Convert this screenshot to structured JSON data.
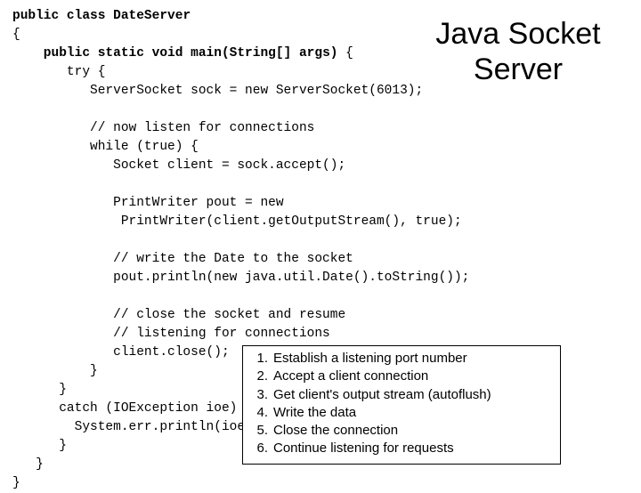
{
  "title": "Java Socket Server",
  "code": {
    "l01a": "public class ",
    "l01b": "DateServer",
    "l02": "{",
    "l03a": "    public static void ",
    "l03b": "main(String[] args)",
    "l03c": " {",
    "l04": "       try {",
    "l05": "          ServerSocket sock = new ServerSocket(6013);",
    "l06": "",
    "l07": "          // now listen for connections",
    "l08": "          while (true) {",
    "l09": "             Socket client = sock.accept();",
    "l10": "",
    "l11": "             PrintWriter pout = new",
    "l12": "              PrintWriter(client.getOutputStream(), true);",
    "l13": "",
    "l14": "             // write the Date to the socket",
    "l15": "             pout.println(new java.util.Date().toString());",
    "l16": "",
    "l17": "             // close the socket and resume",
    "l18": "             // listening for connections",
    "l19": "             client.close();",
    "l20": "          }",
    "l21": "      }",
    "l22": "      catch (IOException ioe) {",
    "l23": "        System.err.println(ioe);",
    "l24": "      }",
    "l25": "   }",
    "l26": "}"
  },
  "steps": [
    {
      "n": "1.",
      "t": "Establish a listening port number"
    },
    {
      "n": "2.",
      "t": "Accept a client connection"
    },
    {
      "n": "3.",
      "t": "Get client's output stream (autoflush)"
    },
    {
      "n": "4.",
      "t": "Write the data"
    },
    {
      "n": "5.",
      "t": "Close the connection"
    },
    {
      "n": "6.",
      "t": "Continue listening for requests"
    }
  ]
}
